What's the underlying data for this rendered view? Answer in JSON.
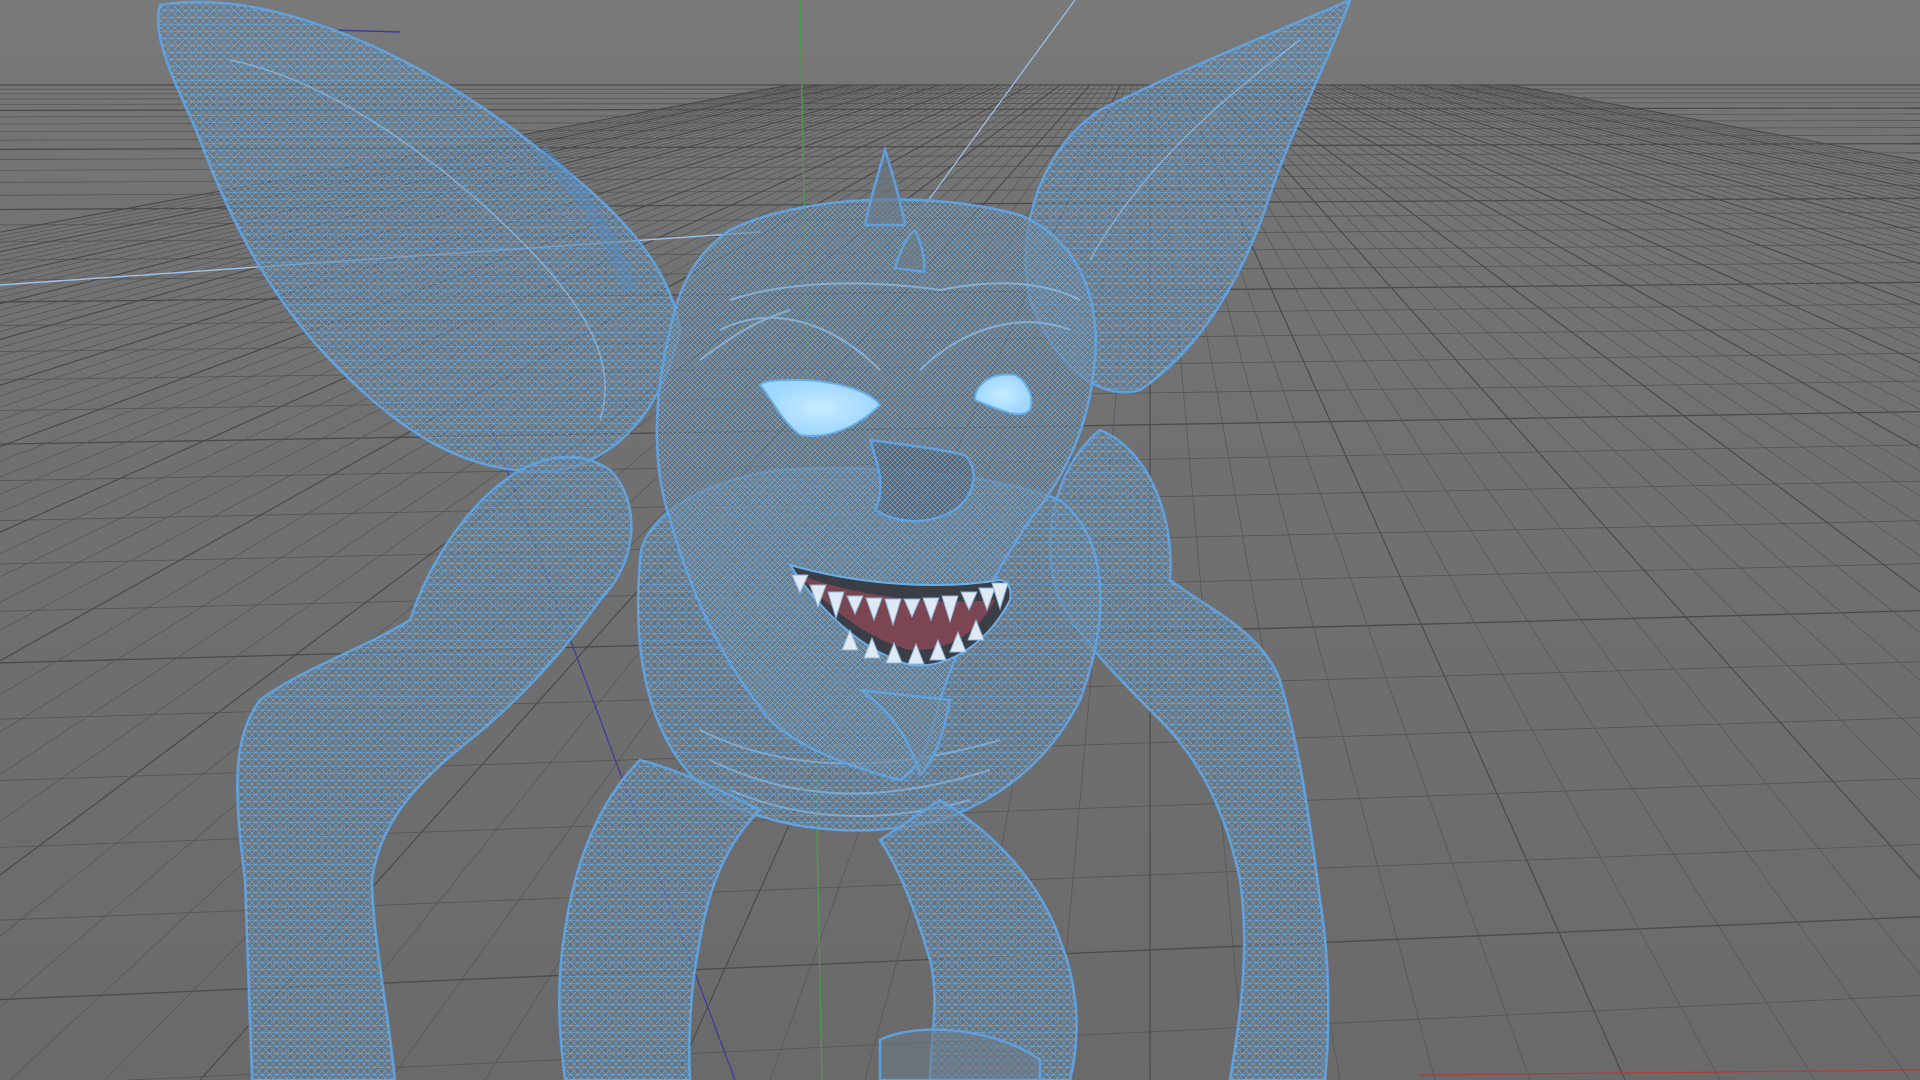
{
  "viewport": {
    "kind": "3d-modeling-perspective-viewport",
    "display_mode": "wireframe",
    "background_color": "#6b6b6b",
    "background_color_horizon": "#7a7a7a",
    "grid": {
      "visible": true,
      "line_color": "#555555",
      "major_line_color": "#4a4a4a"
    },
    "axes": {
      "x_color": "#a84040",
      "y_color": "#4a9a4a",
      "z_color": "#3a3aa0",
      "selection_line_color": "#9ec4ee"
    },
    "model": {
      "subject": "creature-goblin-gremlin",
      "wire_color": "#6aaee8",
      "wire_dark": "#3f78b8",
      "shade_color": "#6d7a86",
      "eye_glow_color": "#9dd6ff",
      "mouth_color": "#b04a5a",
      "teeth_color": "#dfe9f3"
    }
  }
}
